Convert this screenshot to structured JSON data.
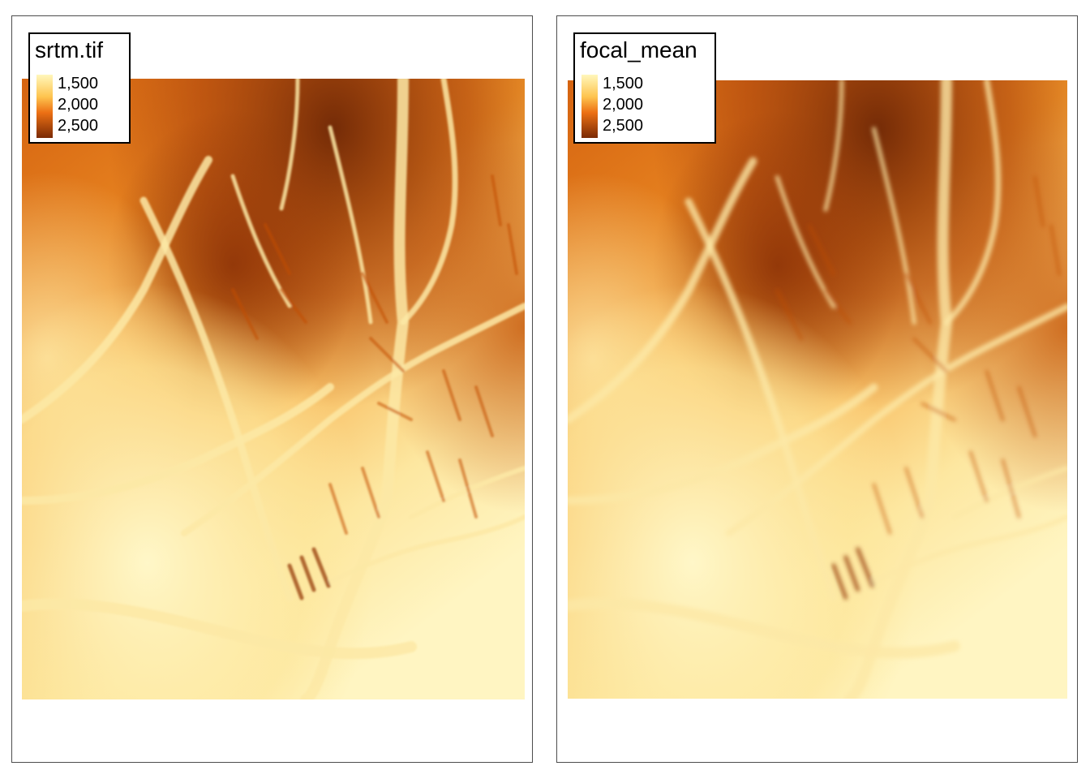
{
  "maps": [
    {
      "legend": {
        "title": "srtm.tif",
        "labels": [
          "1,500",
          "2,000",
          "2,500"
        ]
      }
    },
    {
      "legend": {
        "title": "focal_mean",
        "labels": [
          "1,500",
          "2,000",
          "2,500"
        ]
      }
    }
  ],
  "palette": {
    "low": "#fff7bc",
    "mid_low": "#fec44f",
    "mid": "#fe9929",
    "mid_high": "#ec7014",
    "high": "#993404",
    "dark": "#662506"
  }
}
